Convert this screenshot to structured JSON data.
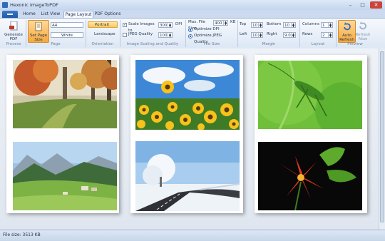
{
  "window": {
    "title": "Hexonic ImageToPDF",
    "minimize": "–",
    "maximize": "□",
    "close": "✕"
  },
  "tabs": [
    {
      "label": "Home"
    },
    {
      "label": "List View"
    },
    {
      "label": "Page Layout",
      "active": true
    },
    {
      "label": "PDF Options"
    }
  ],
  "ribbon": {
    "process": {
      "generate_label": "Generate PDF",
      "group": "Process"
    },
    "page": {
      "set_size_label": "Set Page Size",
      "size_value": "A4",
      "color_value": "White",
      "group": "Page"
    },
    "orientation": {
      "portrait": "Portrait",
      "landscape": "Landscape",
      "group": "Orientation"
    },
    "scaling": {
      "scale_label": "Scale Images to",
      "scale_value": "300",
      "dpi_unit": "DPI",
      "jpeg_label": "JPEG Quality",
      "jpeg_value": "100",
      "group": "Image Scaling and Quality"
    },
    "filesize": {
      "max_label": "Max. File Size",
      "max_value": "400",
      "kb_unit": "KB",
      "opt_dpi": "Optimize DPI",
      "opt_jpeg": "Optimize JPEG Quality",
      "group": "File Size"
    },
    "margin": {
      "top_label": "Top",
      "top_value": "10",
      "bottom_label": "Bottom",
      "bottom_value": "10",
      "left_label": "Left",
      "left_value": "10",
      "right_label": "Right",
      "right_value": "9.0",
      "group": "Margin"
    },
    "layout": {
      "columns_label": "Columns",
      "columns_value": "1",
      "rows_label": "Rows",
      "rows_value": "2",
      "group": "Layout"
    },
    "preview": {
      "auto_label": "Auto Refresh",
      "refresh_label": "Refresh Now",
      "group": "Preview"
    }
  },
  "pages": [
    {
      "images": [
        "autumn-forest-photo",
        "mountain-valley-photo"
      ]
    },
    {
      "images": [
        "sunflower-field-photo",
        "snowy-road-photo"
      ]
    },
    {
      "images": [
        "green-grasshopper-photo",
        "red-flower-photo"
      ]
    }
  ],
  "status": {
    "file_size": "File size: 3513 KB"
  },
  "colors": {
    "accent": "#2f6db8",
    "active_button": "#ffc65a",
    "ribbon_bg": "#dce7f5"
  }
}
